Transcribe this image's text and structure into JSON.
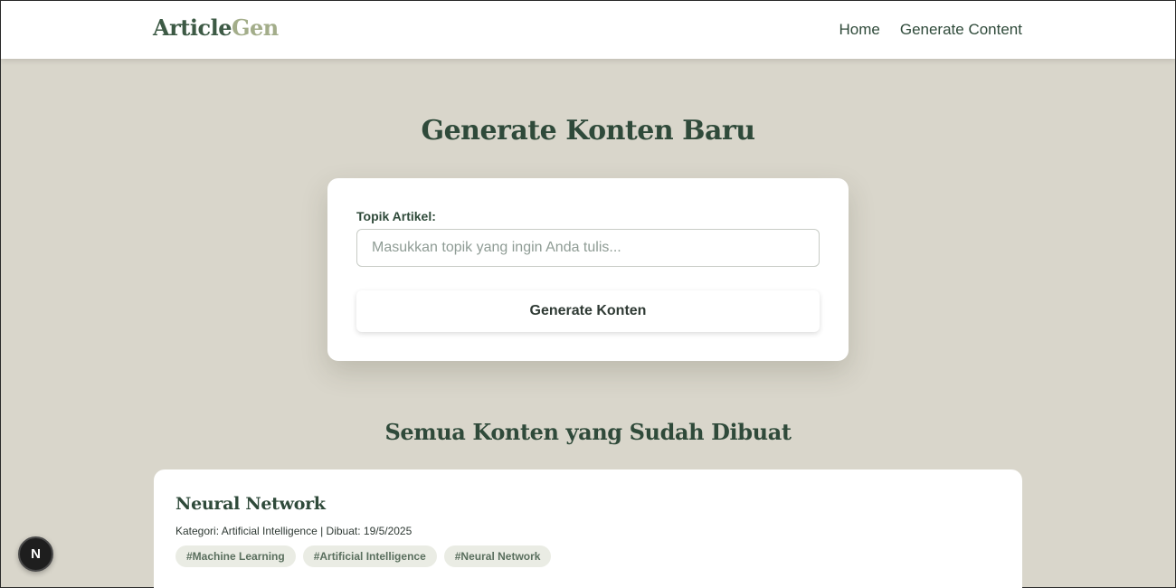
{
  "header": {
    "logo_part_a": "Article",
    "logo_part_b": "Gen",
    "nav": [
      {
        "label": "Home"
      },
      {
        "label": "Generate Content"
      }
    ]
  },
  "main": {
    "title": "Generate Konten Baru",
    "form": {
      "topic_label": "Topik Artikel:",
      "topic_value": "",
      "topic_placeholder": "Masukkan topik yang ingin Anda tulis...",
      "submit_label": "Generate Konten"
    },
    "section_title": "Semua Konten yang Sudah Dibuat",
    "articles": [
      {
        "title": "Neural Network",
        "meta": "Kategori: Artificial Intelligence | Dibuat: 19/5/2025",
        "tags": [
          "#Machine Learning",
          "#Artificial Intelligence",
          "#Neural Network"
        ]
      }
    ]
  },
  "badge": {
    "letter": "N",
    "icon": "nextjs-icon"
  },
  "colors": {
    "background": "#d9d6cb",
    "primary_text": "#2f4a3a",
    "logo_accent": "#a3ad8a",
    "card": "#ffffff",
    "tag_bg": "#eaece4"
  }
}
